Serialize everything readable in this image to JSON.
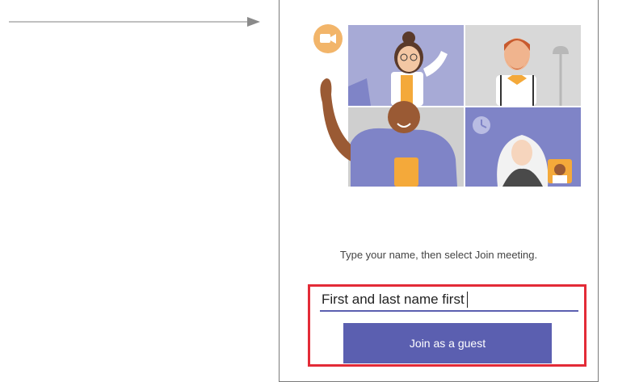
{
  "panel": {
    "instruction": "Type your name, then select Join meeting.",
    "name_input": {
      "value": "First and last name first"
    },
    "join_button_label": "Join as a guest"
  },
  "colors": {
    "accent": "#5b5fb0",
    "highlight": "#e32b37",
    "video_icon_badge": "#f2b56a"
  },
  "icons": [
    "pointer-arrow-icon",
    "video-camera-icon",
    "clock-icon",
    "lamp-icon"
  ]
}
